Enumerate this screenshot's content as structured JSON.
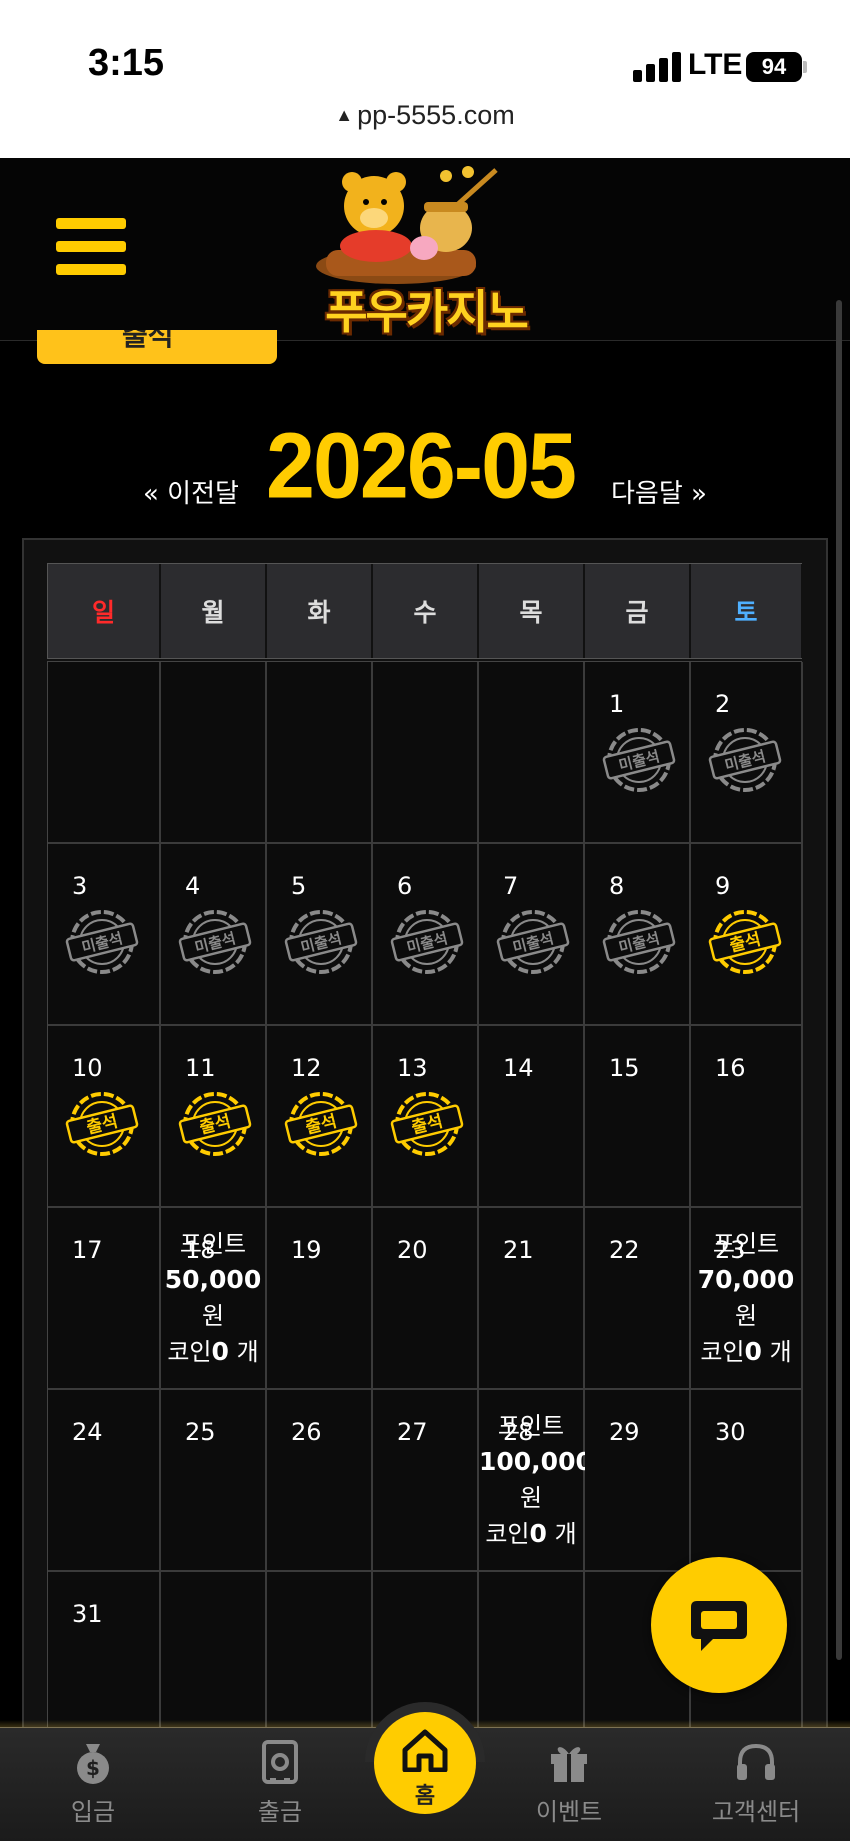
{
  "status_bar": {
    "time": "3:15",
    "network": "LTE",
    "battery": "94"
  },
  "browser": {
    "url": "pp-5555.com"
  },
  "header": {
    "logo_text": "푸우카지노"
  },
  "calendar": {
    "prev_label": "« 이전달",
    "month_title": "2026-05",
    "next_label": "다음달 »",
    "weekdays": [
      "일",
      "월",
      "화",
      "수",
      "목",
      "금",
      "토"
    ],
    "weekday_colors": {
      "sun": "#ff2a2a",
      "sat": "#4fb0ff"
    },
    "stamp_labels": {
      "absent": "미출석",
      "present": "출석"
    },
    "stamp_colors": {
      "absent": "#8a8a8a",
      "present": "#ffcc00"
    },
    "rewards": {
      "18": {
        "label": "포인트",
        "amount": "50,000",
        "unit": "원",
        "coin_label": "코인",
        "coin_value": "0",
        "coin_unit": "개"
      },
      "23": {
        "label": "포인트",
        "amount": "70,000",
        "unit": "원",
        "coin_label": "코인",
        "coin_value": "0",
        "coin_unit": "개"
      },
      "28": {
        "label": "포인트",
        "amount": "100,000",
        "unit": "원",
        "coin_label": "코인",
        "coin_value": "0",
        "coin_unit": "개"
      }
    },
    "days": [
      {
        "day": ""
      },
      {
        "day": ""
      },
      {
        "day": ""
      },
      {
        "day": ""
      },
      {
        "day": ""
      },
      {
        "day": "1",
        "stamp": "absent"
      },
      {
        "day": "2",
        "stamp": "absent"
      },
      {
        "day": "3",
        "stamp": "absent"
      },
      {
        "day": "4",
        "stamp": "absent"
      },
      {
        "day": "5",
        "stamp": "absent"
      },
      {
        "day": "6",
        "stamp": "absent"
      },
      {
        "day": "7",
        "stamp": "absent"
      },
      {
        "day": "8",
        "stamp": "absent"
      },
      {
        "day": "9",
        "stamp": "present"
      },
      {
        "day": "10",
        "stamp": "present"
      },
      {
        "day": "11",
        "stamp": "present"
      },
      {
        "day": "12",
        "stamp": "present"
      },
      {
        "day": "13",
        "stamp": "present"
      },
      {
        "day": "14"
      },
      {
        "day": "15"
      },
      {
        "day": "16"
      },
      {
        "day": "17"
      },
      {
        "day": "18",
        "reward": "18"
      },
      {
        "day": "19"
      },
      {
        "day": "20"
      },
      {
        "day": "21"
      },
      {
        "day": "22"
      },
      {
        "day": "23",
        "reward": "23"
      },
      {
        "day": "24"
      },
      {
        "day": "25"
      },
      {
        "day": "26"
      },
      {
        "day": "27"
      },
      {
        "day": "28",
        "reward": "28"
      },
      {
        "day": "29"
      },
      {
        "day": "30"
      },
      {
        "day": "31"
      },
      {
        "day": ""
      },
      {
        "day": ""
      },
      {
        "day": ""
      },
      {
        "day": ""
      },
      {
        "day": ""
      },
      {
        "day": ""
      }
    ]
  },
  "bottom_nav": {
    "items": [
      {
        "label": "입금",
        "icon": "money-bag-icon"
      },
      {
        "label": "출금",
        "icon": "safe-icon"
      },
      {
        "label": "홈",
        "icon": "home-icon"
      },
      {
        "label": "이벤트",
        "icon": "gift-icon"
      },
      {
        "label": "고객센터",
        "icon": "headset-icon"
      }
    ]
  },
  "chat_button": {
    "icon": "chat-bubble-icon"
  }
}
